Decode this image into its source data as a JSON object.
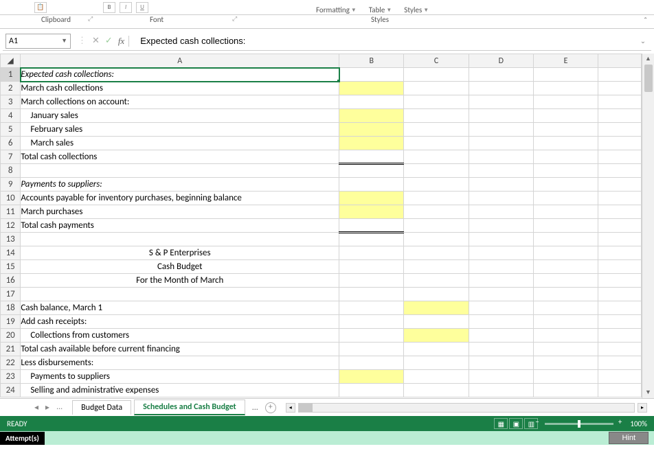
{
  "ribbon": {
    "groups": {
      "clipboard": "Clipboard",
      "font": "Font",
      "styles": "Styles"
    },
    "items": {
      "formatting": "Formatting",
      "table": "Table",
      "styles": "Styles"
    }
  },
  "nameBox": "A1",
  "formulaBar": "Expected cash collections:",
  "columns": [
    "A",
    "B",
    "C",
    "D",
    "E"
  ],
  "rows": [
    {
      "n": 1,
      "A": "Expected cash collections:",
      "Aclass": "bold-italic",
      "active": true
    },
    {
      "n": 2,
      "A": "March cash collections",
      "Byellow": true
    },
    {
      "n": 3,
      "A": "March collections on account:"
    },
    {
      "n": 4,
      "A": "January sales",
      "Aclass": "indent1",
      "Byellow": true
    },
    {
      "n": 5,
      "A": "February sales",
      "Aclass": "indent1",
      "Byellow": true
    },
    {
      "n": 6,
      "A": "March sales",
      "Aclass": "indent1",
      "Byellow": true,
      "Btop": true
    },
    {
      "n": 7,
      "A": "Total cash collections",
      "Bdouble": true
    },
    {
      "n": 8,
      "A": ""
    },
    {
      "n": 9,
      "A": "Payments to suppliers:",
      "Aclass": "bold-italic"
    },
    {
      "n": 10,
      "A": "Accounts payable for inventory purchases, beginning balance",
      "Byellow": true
    },
    {
      "n": 11,
      "A": "March purchases",
      "Byellow": true,
      "Btop": true
    },
    {
      "n": 12,
      "A": "Total cash payments",
      "Bdouble": true
    },
    {
      "n": 13,
      "A": ""
    },
    {
      "n": 14,
      "A": "S & P Enterprises",
      "Aclass": "center"
    },
    {
      "n": 15,
      "A": "Cash Budget",
      "Aclass": "center"
    },
    {
      "n": 16,
      "A": "For the Month of March",
      "Aclass": "center"
    },
    {
      "n": 17,
      "A": ""
    },
    {
      "n": 18,
      "A": "Cash balance, March 1",
      "Cyellow": true
    },
    {
      "n": 19,
      "A": "Add cash receipts:"
    },
    {
      "n": 20,
      "A": "Collections from customers",
      "Aclass": "indent1",
      "Cyellow": true,
      "Ctop": true
    },
    {
      "n": 21,
      "A": "Total cash available before current financing",
      "Ctop": true
    },
    {
      "n": 22,
      "A": "Less disbursements:"
    },
    {
      "n": 23,
      "A": "Payments to suppliers",
      "Aclass": "indent1",
      "Byellow": true
    },
    {
      "n": 24,
      "A": "Selling and administrative expenses",
      "Aclass": "indent1"
    }
  ],
  "tabs": {
    "budgetData": "Budget Data",
    "schedules": "Schedules and Cash Budget"
  },
  "status": {
    "ready": "READY",
    "zoom": "100%"
  },
  "attempts": {
    "label": "Attempt(s)",
    "hint": "Hint"
  }
}
